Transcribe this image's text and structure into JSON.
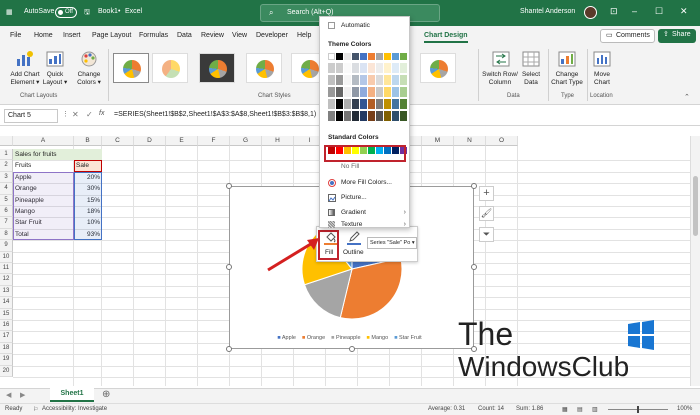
{
  "titlebar": {
    "autosave": "AutoSave",
    "toggle": "Off",
    "book": "Book1",
    "sep": "•",
    "app": "Excel",
    "search": "Search (Alt+Q)",
    "user": "Shantel Anderson"
  },
  "menu": [
    "File",
    "Home",
    "Insert",
    "Page Layout",
    "Formulas",
    "Data",
    "Review",
    "View",
    "Developer",
    "Help",
    "Chart Design"
  ],
  "buttons": {
    "comments": "Comments",
    "share": "Share"
  },
  "ribbon": {
    "add_chart_element": [
      "Add Chart",
      "Element ▾"
    ],
    "quick_layout": [
      "Quick",
      "Layout ▾"
    ],
    "change_colors": [
      "Change",
      "Colors ▾"
    ],
    "switch_row_col": [
      "Switch Row/",
      "Column"
    ],
    "select_data": [
      "Select",
      "Data"
    ],
    "change_chart_type": [
      "Change",
      "Chart Type"
    ],
    "move_chart": [
      "Move",
      "Chart"
    ],
    "groups": [
      "Chart Layouts",
      "Chart Styles",
      "Data",
      "Type",
      "Location"
    ]
  },
  "formula_bar": {
    "name_box": "Chart 5",
    "formula": "=SERIES(Sheet1!$B$2,Sheet1!$A$3:$A$8,Sheet1!$B$3:$B$8,1)"
  },
  "columns": [
    "A",
    "B",
    "C",
    "D",
    "E",
    "F",
    "G",
    "H",
    "I",
    "J",
    "K",
    "L",
    "M",
    "N",
    "O"
  ],
  "rows": [
    "1",
    "2",
    "3",
    "4",
    "5",
    "6",
    "7",
    "8",
    "9",
    "10",
    "11",
    "12",
    "13",
    "14",
    "15",
    "16",
    "17",
    "18",
    "19",
    "20"
  ],
  "sheet": {
    "title": "Sales  for fruits",
    "headers": [
      "Fruits",
      "Sale"
    ],
    "data": [
      {
        "fruit": "Apple",
        "sale": "20%"
      },
      {
        "fruit": "Orange",
        "sale": "30%"
      },
      {
        "fruit": "Pineapple",
        "sale": "15%"
      },
      {
        "fruit": "Mango",
        "sale": "18%"
      },
      {
        "fruit": "Star Fruit",
        "sale": "10%"
      },
      {
        "fruit": "Total",
        "sale": "93%"
      }
    ]
  },
  "chart_data": {
    "type": "pie",
    "title": "",
    "categories": [
      "Apple",
      "Orange",
      "Pineapple",
      "Mango",
      "Star Fruit"
    ],
    "values": [
      20,
      30,
      15,
      18,
      10
    ],
    "colors": [
      "#4472c4",
      "#ed7d31",
      "#a5a5a5",
      "#ffc000",
      "#5b9bd5"
    ],
    "legend_position": "bottom"
  },
  "mini_toolbar": {
    "fill": "Fill",
    "outline": "Outline",
    "series": "Series \"Sale\" Po ▾"
  },
  "fill_menu": {
    "automatic": "Automatic",
    "theme_colors": "Theme Colors",
    "standard_colors": "Standard Colors",
    "no_fill": "No Fill",
    "more_colors": "More Fill Colors...",
    "picture": "Picture...",
    "gradient": "Gradient",
    "texture": "Texture",
    "theme_top": [
      "#ffffff",
      "#000000",
      "#e7e6e6",
      "#44546a",
      "#4472c4",
      "#ed7d31",
      "#a5a5a5",
      "#ffc000",
      "#5b9bd5",
      "#70ad47"
    ],
    "standard": [
      "#c00000",
      "#ff0000",
      "#ffc000",
      "#ffff00",
      "#92d050",
      "#00b050",
      "#00b0f0",
      "#0070c0",
      "#002060",
      "#7030a0"
    ]
  },
  "sheet_tab": "Sheet1",
  "status": {
    "ready": "Ready",
    "accessibility": "Accessibility: Investigate",
    "average": "Average: 0.31",
    "count": "Count: 14",
    "sum": "Sum: 1.86",
    "zoom": "100%"
  },
  "watermark": {
    "line1": "The",
    "line2": "WindowsClub"
  },
  "accent": "#217346",
  "highlight": "#c0232d"
}
